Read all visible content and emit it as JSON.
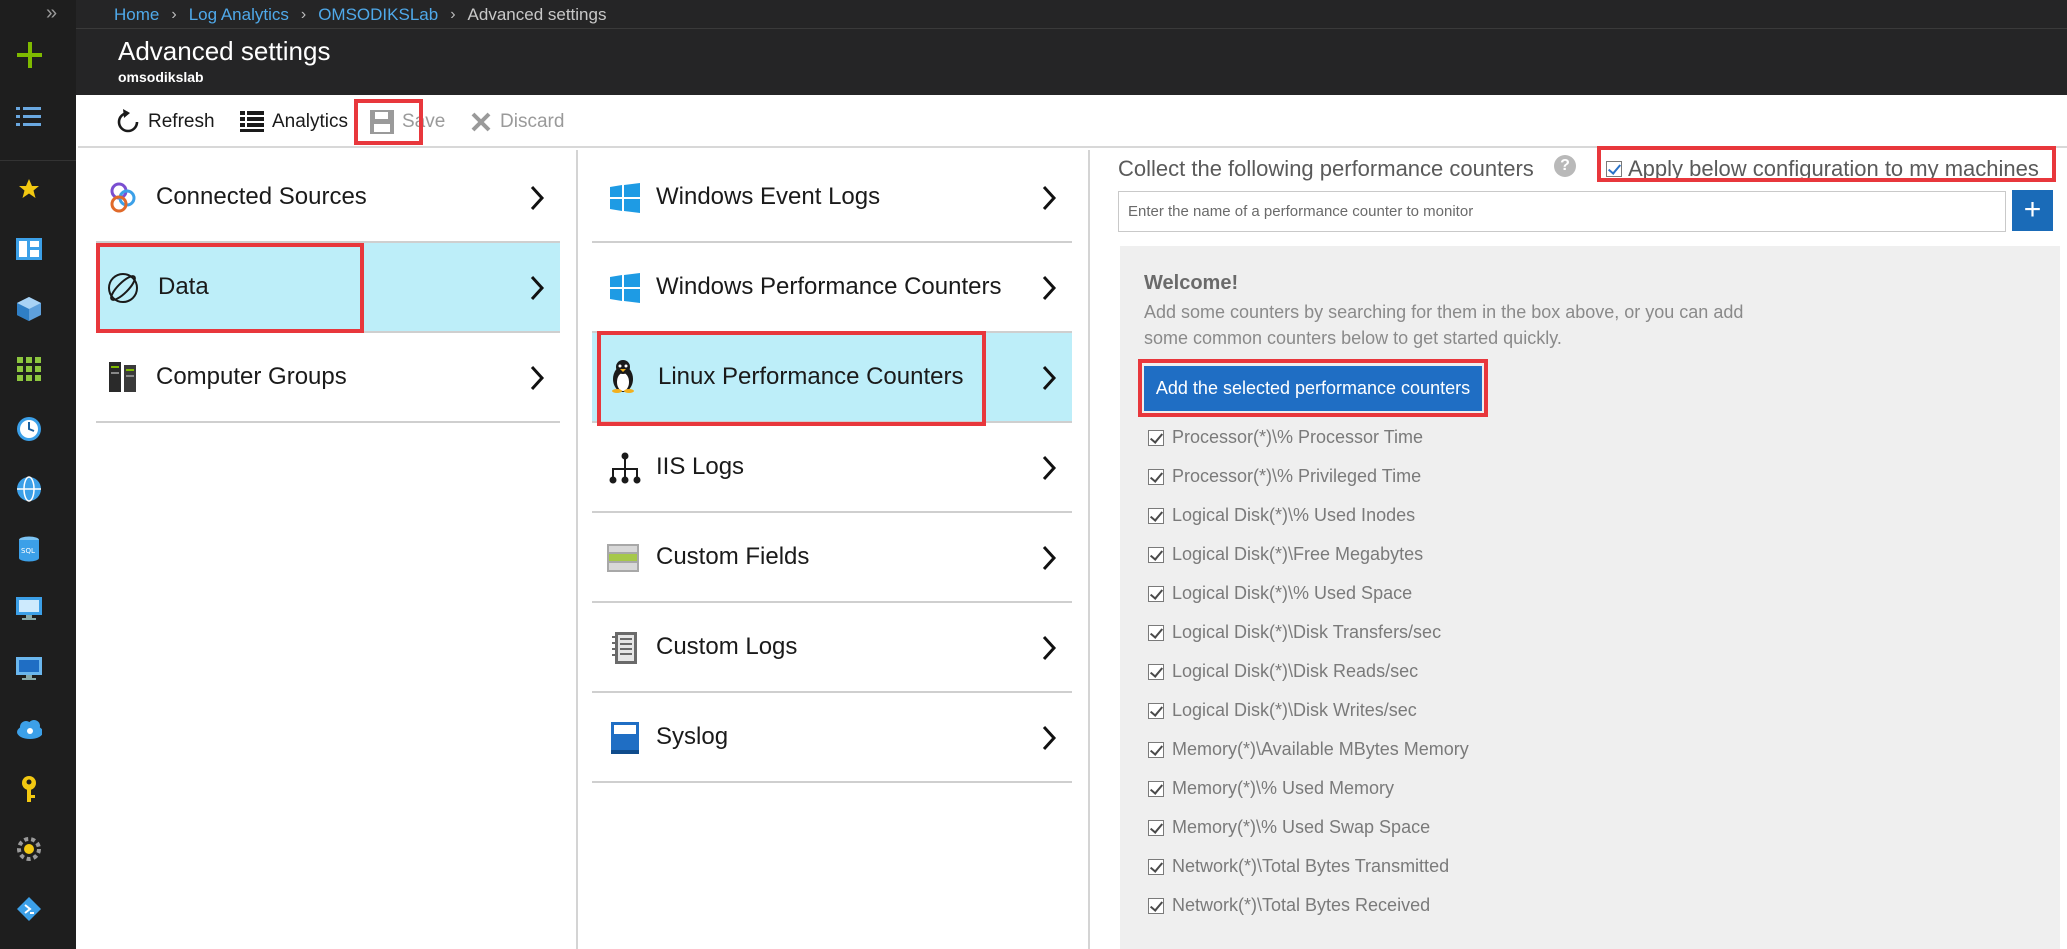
{
  "breadcrumb": [
    "Home",
    "Log Analytics",
    "OMSODIKSLab",
    "Advanced settings"
  ],
  "page": {
    "title": "Advanced settings",
    "subtitle": "omsodikslab"
  },
  "toolbar": {
    "refresh": "Refresh",
    "analytics": "Analytics",
    "save": "Save",
    "discard": "Discard"
  },
  "rail": {
    "icons": [
      "expand-icon",
      "create-icon",
      "menu-icon",
      "favorite-star-icon",
      "dashboard-icon",
      "resource-cube-icon",
      "all-services-grid-icon",
      "clock-icon",
      "globe-icon",
      "sql-database-icon",
      "virtual-machine-icon",
      "monitor-icon",
      "cloud-gear-icon",
      "key-icon",
      "settings-gear-icon",
      "devops-icon"
    ]
  },
  "nav1": [
    {
      "label": "Connected Sources",
      "icon": "connected-sources-icon"
    },
    {
      "label": "Data",
      "icon": "data-icon"
    },
    {
      "label": "Computer Groups",
      "icon": "computer-groups-icon"
    }
  ],
  "nav2": [
    {
      "label": "Windows Event Logs",
      "icon": "windows-logo-icon"
    },
    {
      "label": "Windows Performance Counters",
      "icon": "windows-logo-icon"
    },
    {
      "label": "Linux Performance Counters",
      "icon": "linux-penguin-icon"
    },
    {
      "label": "IIS Logs",
      "icon": "iis-network-icon"
    },
    {
      "label": "Custom Fields",
      "icon": "custom-fields-icon"
    },
    {
      "label": "Custom Logs",
      "icon": "custom-logs-icon"
    },
    {
      "label": "Syslog",
      "icon": "syslog-book-icon"
    }
  ],
  "panel": {
    "collect_label": "Collect the following performance counters",
    "help": "?",
    "apply_label": "Apply below configuration to my machines",
    "search_placeholder": "Enter the name of a performance counter to monitor",
    "plus": "+",
    "welcome_title": "Welcome!",
    "welcome_text": "Add some counters by searching for them in the box above, or you can add some common counters below to get started quickly.",
    "add_button": "Add the selected performance counters",
    "counters": [
      "Processor(*)\\% Processor Time",
      "Processor(*)\\% Privileged Time",
      "Logical Disk(*)\\% Used Inodes",
      "Logical Disk(*)\\Free Megabytes",
      "Logical Disk(*)\\% Used Space",
      "Logical Disk(*)\\Disk Transfers/sec",
      "Logical Disk(*)\\Disk Reads/sec",
      "Logical Disk(*)\\Disk Writes/sec",
      "Memory(*)\\Available MBytes Memory",
      "Memory(*)\\% Used Memory",
      "Memory(*)\\% Used Swap Space",
      "Network(*)\\Total Bytes Transmitted",
      "Network(*)\\Total Bytes Received"
    ]
  },
  "colors": {
    "accent": "#1f6ec4",
    "selected": "#bdeef9",
    "highlight": "#e8373c",
    "rail": "#1e1e1e"
  }
}
